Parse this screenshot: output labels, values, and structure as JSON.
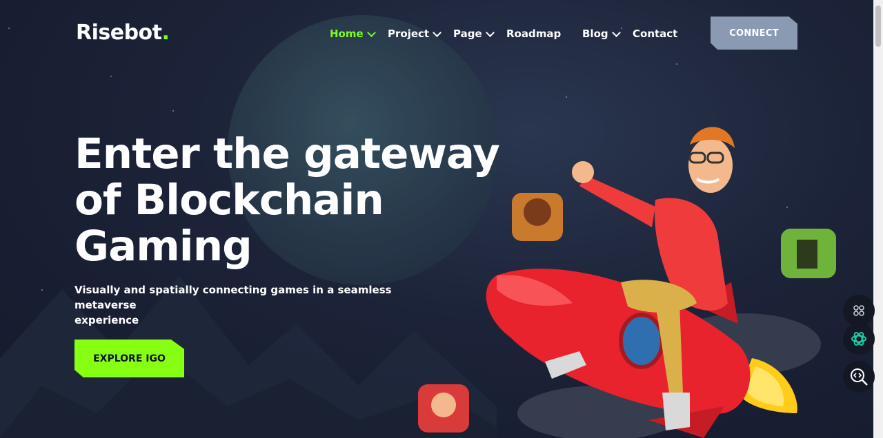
{
  "brand": {
    "name": "Risebot",
    "accent": "#7cff1c"
  },
  "nav": {
    "items": [
      {
        "label": "Home",
        "has_dropdown": true,
        "active": true
      },
      {
        "label": "Project",
        "has_dropdown": true,
        "active": false
      },
      {
        "label": "Page",
        "has_dropdown": true,
        "active": false
      },
      {
        "label": "Roadmap",
        "has_dropdown": false,
        "active": false
      },
      {
        "label": "Blog",
        "has_dropdown": true,
        "active": false
      },
      {
        "label": "Contact",
        "has_dropdown": false,
        "active": false
      }
    ],
    "connect_label": "CONNECT"
  },
  "hero": {
    "title_line1": "Enter the gateway",
    "title_line2": "of Blockchain",
    "title_line3": "Gaming",
    "subtitle_line1": "Visually and spatially connecting games in a seamless metaverse",
    "subtitle_line2": "experience",
    "cta_label": "EXPLORE IGO"
  },
  "side_widgets": [
    {
      "icon": "grid-icon"
    },
    {
      "icon": "openai-icon"
    },
    {
      "icon": "code-search-icon"
    }
  ],
  "colors": {
    "background": "#1a2036",
    "cta": "#86ff12",
    "connect_button": "#8a9ab2"
  }
}
